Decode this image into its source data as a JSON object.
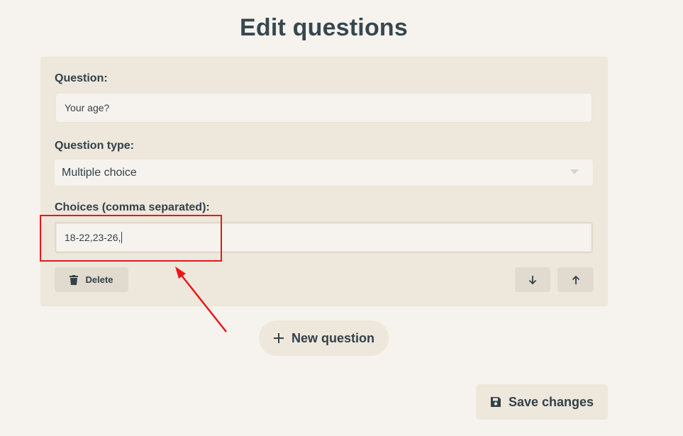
{
  "page": {
    "title": "Edit questions"
  },
  "question_card": {
    "question_label": "Question:",
    "question_value": "Your age?",
    "type_label": "Question type:",
    "type_value": "Multiple choice",
    "choices_label": "Choices (comma separated):",
    "choices_value": "18-22,23-26,",
    "delete_label": "Delete"
  },
  "actions": {
    "new_question_label": "New question",
    "save_label": "Save changes"
  },
  "annotation": {
    "highlight_color": "#e8161a"
  },
  "colors": {
    "background": "#f6f3ee",
    "card": "#ede7dc",
    "button": "#e0dacf",
    "text": "#334148"
  },
  "icons": [
    "trash-icon",
    "arrow-down-icon",
    "arrow-up-icon",
    "plus-icon",
    "save-icon",
    "chevron-down-icon"
  ]
}
